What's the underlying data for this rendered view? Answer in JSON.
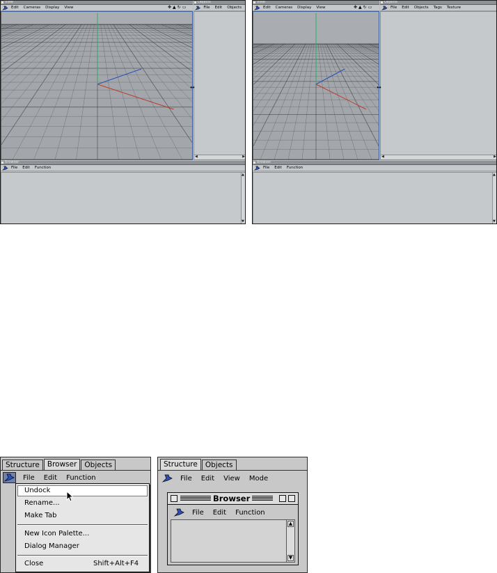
{
  "top_left": {
    "viewport_title": "View",
    "viewport_menu": [
      "Edit",
      "Cameras",
      "Display",
      "View"
    ],
    "objects_title": "Objects",
    "objects_menu": [
      "File",
      "Edit",
      "Objects"
    ],
    "browser_title": "Browser",
    "browser_menu": [
      "File",
      "Edit",
      "Function"
    ]
  },
  "top_right": {
    "viewport_title": "View",
    "viewport_menu": [
      "Edit",
      "Cameras",
      "Display",
      "View"
    ],
    "objects_title": "Objects",
    "objects_menu": [
      "File",
      "Edit",
      "Objects",
      "Tags",
      "Texture"
    ],
    "browser_title": "Browser",
    "browser_menu": [
      "File",
      "Edit",
      "Function"
    ]
  },
  "bottom_left": {
    "tabs": [
      "Structure",
      "Browser",
      "Objects"
    ],
    "active_tab": "Browser",
    "menu": [
      "File",
      "Edit",
      "Function"
    ],
    "dropdown": [
      {
        "label": "Undock",
        "shortcut": ""
      },
      {
        "label": "Rename...",
        "shortcut": ""
      },
      {
        "label": "Make Tab",
        "shortcut": ""
      },
      {
        "label": "New Icon Palette...",
        "shortcut": ""
      },
      {
        "label": "Dialog Manager",
        "shortcut": ""
      },
      {
        "label": "Close",
        "shortcut": "Shift+Alt+F4"
      }
    ]
  },
  "bottom_right": {
    "tabs": [
      "Structure",
      "Objects"
    ],
    "menu": [
      "File",
      "Edit",
      "View",
      "Mode"
    ],
    "window_title": "Browser",
    "window_menu": [
      "File",
      "Edit",
      "Function"
    ]
  },
  "colors": {
    "ui_gray": "#c8c8c8",
    "viewport_sky": "#a9adb1",
    "grid_line": "#2f3236",
    "axis_x": "#c0392b",
    "axis_y": "#27ae60",
    "axis_z": "#2c4fb8",
    "selection_blue": "#3b5f9c"
  },
  "icons": [
    "pin-icon",
    "move-icon",
    "camera-icon",
    "rotate-icon",
    "maximize-icon",
    "cursor-arrow-icon",
    "resize-arrow-icon"
  ]
}
